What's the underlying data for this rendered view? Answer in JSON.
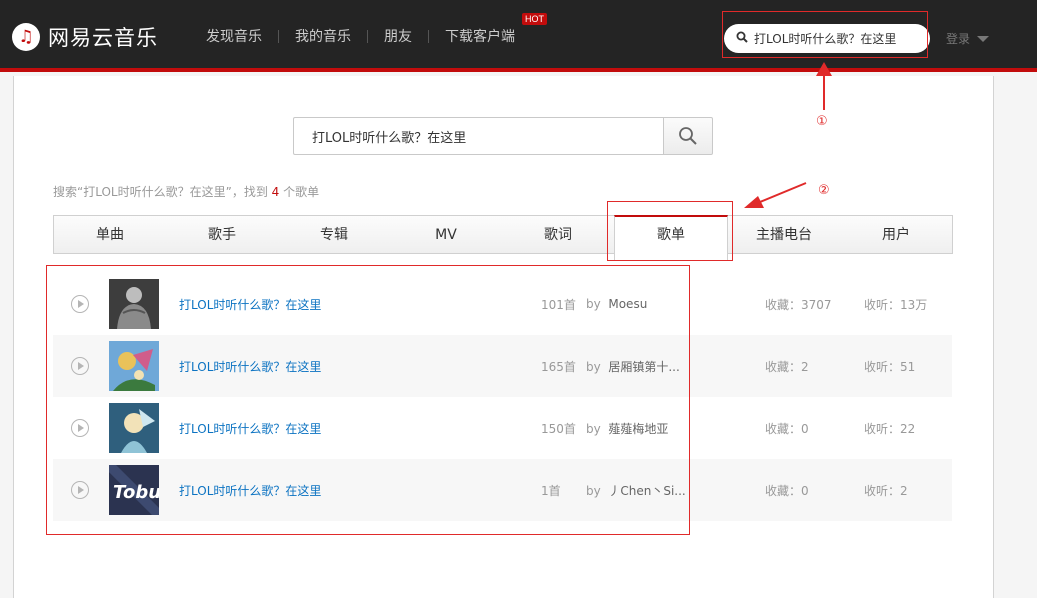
{
  "header": {
    "logo_text": "网易云音乐",
    "nav": [
      "发现音乐",
      "我的音乐",
      "朋友",
      "下载客户端"
    ],
    "hot_badge": "HOT",
    "search_value": "打LOL时听什么歌？在这里",
    "login_label": "登录"
  },
  "search": {
    "query": "打LOL时听什么歌？在这里"
  },
  "summary": {
    "prefix": "搜索“打LOL时听什么歌？在这里”，找到 ",
    "count": "4",
    "suffix": " 个歌单"
  },
  "tabs": [
    {
      "label": "单曲",
      "active": false
    },
    {
      "label": "歌手",
      "active": false
    },
    {
      "label": "专辑",
      "active": false
    },
    {
      "label": "MV",
      "active": false
    },
    {
      "label": "歌词",
      "active": false
    },
    {
      "label": "歌单",
      "active": true
    },
    {
      "label": "主播电台",
      "active": false
    },
    {
      "label": "用户",
      "active": false
    }
  ],
  "playlists": [
    {
      "name": "打LOL时听什么歌？在这里",
      "count": "101首",
      "by_label": "by",
      "creator": "Moesu",
      "fav": "收藏：3707",
      "listen": "收听：13万"
    },
    {
      "name": "打LOL时听什么歌？在这里",
      "count": "165首",
      "by_label": "by",
      "creator": "居厢镇第十...",
      "fav": "收藏：2",
      "listen": "收听：51"
    },
    {
      "name": "打LOL时听什么歌？在这里",
      "count": "150首",
      "by_label": "by",
      "creator": "薤薤梅地亚",
      "fav": "收藏：0",
      "listen": "收听：22"
    },
    {
      "name": "打LOL时听什么歌？在这里",
      "count": "1首",
      "by_label": "by",
      "creator": "丿Chen丶Si...",
      "fav": "收藏：0",
      "listen": "收听：2"
    }
  ],
  "annotations": [
    "①",
    "②"
  ],
  "colors": {
    "accent": "#c20c0c",
    "annotation": "#e02a2a",
    "link": "#0c73c2"
  }
}
